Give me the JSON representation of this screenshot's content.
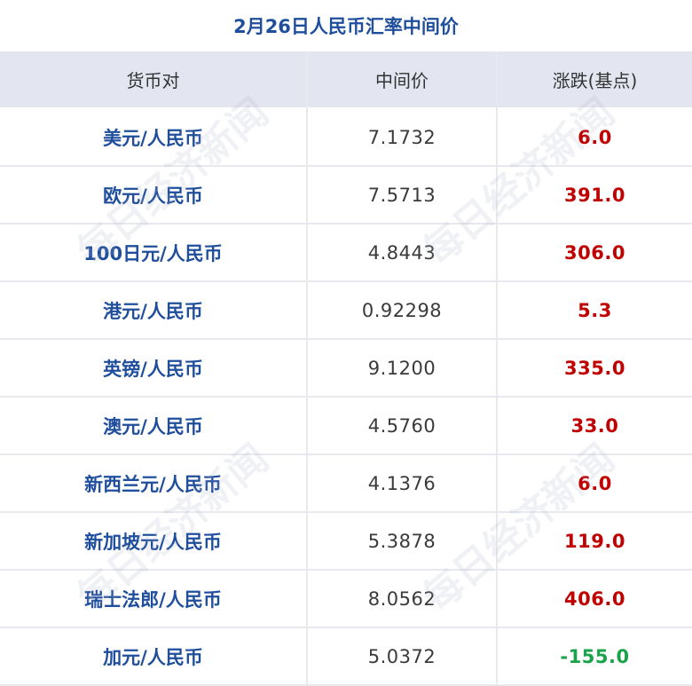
{
  "title": "2月26日人民币汇率中间价",
  "headers": {
    "pair": "货币对",
    "mid": "中间价",
    "change": "涨跌(基点)"
  },
  "rows": [
    {
      "pair": "美元/人民币",
      "mid": "7.1732",
      "change": "6.0"
    },
    {
      "pair": "欧元/人民币",
      "mid": "7.5713",
      "change": "391.0"
    },
    {
      "pair": "100日元/人民币",
      "mid": "4.8443",
      "change": "306.0"
    },
    {
      "pair": "港元/人民币",
      "mid": "0.92298",
      "change": "5.3"
    },
    {
      "pair": "英镑/人民币",
      "mid": "9.1200",
      "change": "335.0"
    },
    {
      "pair": "澳元/人民币",
      "mid": "4.5760",
      "change": "33.0"
    },
    {
      "pair": "新西兰元/人民币",
      "mid": "4.1376",
      "change": "6.0"
    },
    {
      "pair": "新加坡元/人民币",
      "mid": "5.3878",
      "change": "119.0"
    },
    {
      "pair": "瑞士法郎/人民币",
      "mid": "8.0562",
      "change": "406.0"
    },
    {
      "pair": "加元/人民币",
      "mid": "5.0372",
      "change": "-155.0"
    }
  ],
  "watermark": "每日经济新闻",
  "colors": {
    "title": "#1f4e9c",
    "pair": "#1f4e9c",
    "up": "#c00000",
    "down": "#1aa34a",
    "header_bg": "#e3e6f0"
  }
}
